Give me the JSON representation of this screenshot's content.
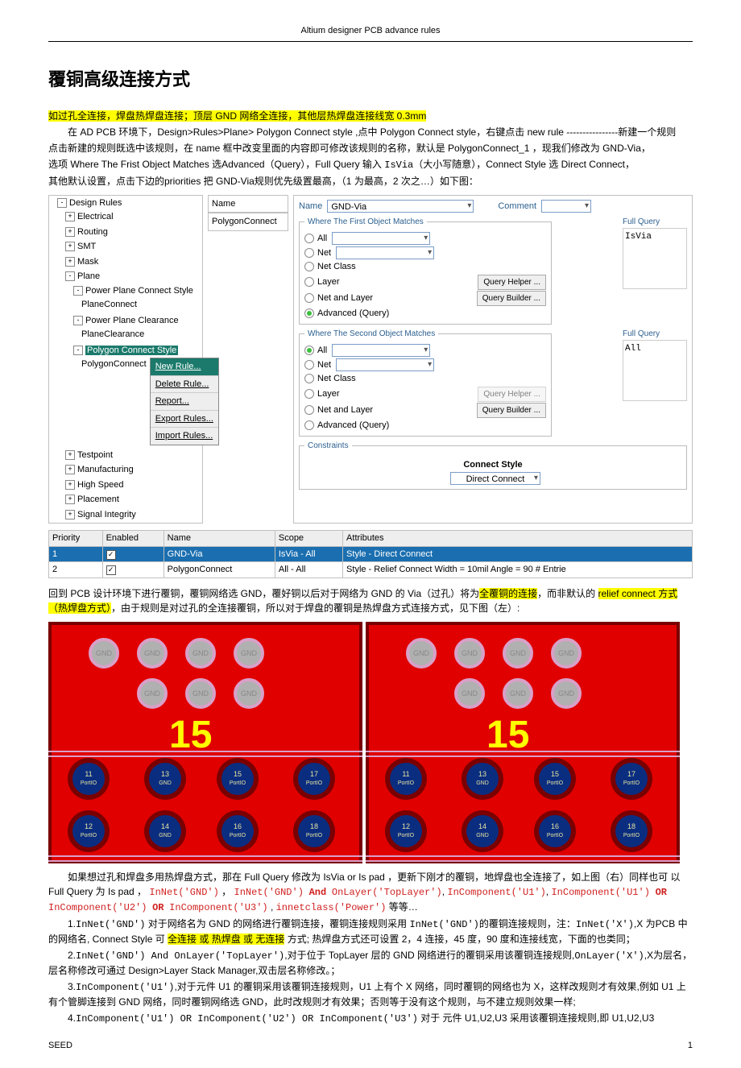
{
  "header": "Altium designer PCB advance rules",
  "title": "覆铜高级连接方式",
  "intro_hl": "如过孔全连接，焊盘热焊盘连接；顶层 GND 网络全连接，其他层热焊盘连接线宽 0.3mm",
  "p1_a": "在 AD PCB 环境下，Design>Rules>Plane> Polygon Connect style ,点中 Polygon Connect style，右键点击 new rule     ----------------新建一个规则",
  "p1_b": "点击新建的规则既选中该规则，在 name 框中改变里面的内容即可修改该规则的名称，默认是 PolygonConnect_1 ，现我们修改为 GND-Via，",
  "p1_c": "选项  Where The Frist Object Matches  选Advanced（Query），Full Query  输入 ",
  "p1_c_code": "IsVia",
  "p1_c2": "（大小写随意），Connect Style 选 Direct Connect，",
  "p1_d": "其他默认设置，点击下边的priorities  把 GND-Via规则优先级置最高，（1 为最高，2 次之…）如下图：",
  "tree": {
    "root": "Design Rules",
    "items": [
      "Electrical",
      "Routing",
      "SMT",
      "Mask",
      "Plane",
      "Power Plane Connect Style",
      "PlaneConnect",
      "Power Plane Clearance",
      "PlaneClearance",
      "Polygon Connect Style",
      "PolygonConnect",
      "Testpoint",
      "Manufacturing",
      "High Speed",
      "Placement",
      "Signal Integrity"
    ]
  },
  "ctx_menu": [
    "New Rule...",
    "Delete Rule...",
    "Report...",
    "Export Rules...",
    "Import Rules..."
  ],
  "name_col": {
    "head": "Name",
    "val": "PolygonConnect"
  },
  "panel": {
    "name_label": "Name",
    "name_val": "GND-Via",
    "comment_label": "Comment",
    "legend1": "Where The First Object Matches",
    "legend2": "Where The Second Object Matches",
    "legendFQ": "Full Query",
    "opts": [
      "All",
      "Net",
      "Net Class",
      "Layer",
      "Net and Layer",
      "Advanced (Query)"
    ],
    "helper": "Query Helper ...",
    "builder": "Query Builder ...",
    "fq1": "IsVia",
    "fq2": "All",
    "constraints_legend": "Constraints",
    "connect_style_label": "Connect Style",
    "connect_style_val": "Direct Connect"
  },
  "prio": {
    "cols": [
      "Priority",
      "Enabled",
      "Name",
      "Scope",
      "Attributes"
    ],
    "rows": [
      {
        "p": "1",
        "en": "✓",
        "name": "GND-Via",
        "scope": "IsVia   -   All",
        "attr": "Style - Direct Connect"
      },
      {
        "p": "2",
        "en": "✓",
        "name": "PolygonConnect",
        "scope": "All   -   All",
        "attr": "Style - Relief Connect    Width = 10mil    Angle = 90    # Entrie"
      }
    ]
  },
  "para2_a": "回到 PCB 设计环境下进行覆铜，覆铜网络选 GND，覆好铜以后对于网络为 GND 的 Via（过孔）将为",
  "para2_hl1": "全覆铜的连接",
  "para2_b": "，而非默认的 ",
  "para2_hl2": "relief connect 方式（热焊盘方式）",
  "para2_c": "，由于规则是对过孔的全连接覆铜，所以对于焊盘的覆铜是热焊盘方式连接方式，见下图（左）:",
  "big15": "15",
  "pad_gnd": "GND",
  "pad_labels": [
    {
      "t": "11",
      "b": "PortIO"
    },
    {
      "t": "13",
      "b": "GND"
    },
    {
      "t": "15",
      "b": "PortIO"
    },
    {
      "t": "17",
      "b": "PortIO"
    },
    {
      "t": "12",
      "b": "PortIO"
    },
    {
      "t": "14",
      "b": "GND"
    },
    {
      "t": "16",
      "b": "PortIO"
    },
    {
      "t": "18",
      "b": "PortIO"
    }
  ],
  "para3_a": "如果想过孔和焊盘多用热焊盘方式，那在 Full Query  修改为  IsVia or Is pad  ，更新下刚才的覆铜，地焊盘也全连接了，如上图（右）同样也可  以   Full   Query   为    Is   pad   ，",
  "para3_code1": "InNet('GND')",
  "para3_sep": " ， ",
  "para3_code2": "InNet('GND')",
  "para3_and": "And",
  "para3_code3": "OnLayer('TopLayer')",
  "para3_comma": ",   ",
  "para3_code4": "InComponent('U1')",
  "para3_comma2": ",",
  "para3_code5": "InComponent('U1')",
  "para3_or": "OR",
  "para3_code6": "InComponent('U2')",
  "para3_code7": "InComponent('U3')",
  "para3_comma3": " ,  ",
  "para3_code8": "innetclass('Power')",
  "para3_end": "等等…",
  "li1_a": "1.",
  "li1_code1": "InNet('GND')",
  "li1_b": " 对于网络名为 GND 的网络进行覆铜连接，覆铜连接规则采用 ",
  "li1_code2": "InNet('GND')",
  "li1_c": "的覆铜连接规则，注：",
  "li1_code3": "InNet('X')",
  "li1_d": ",X 为PCB 中的网络名, Connect Style 可 ",
  "li1_hl": "全连接 或 热焊盘 或 无连接",
  "li1_e": " 方式; 热焊盘方式还可设置 2，4 连接，45 度，90 度和连接线宽，下面的也类同；",
  "li2_a": "2.",
  "li2_code1": "InNet('GND') And OnLayer('TopLayer')",
  "li2_b": ",对于位于 TopLayer 层的 GND 网络进行的覆铜采用该覆铜连接规则,",
  "li2_code2": "OnLayer('X')",
  "li2_c": ",X为层名，层名称修改可通过 Design>Layer Stack Manager,双击层名称修改。；",
  "li3_a": "3.",
  "li3_code1": "InComponent('U1')",
  "li3_b": ",对于元件 U1 的覆铜采用该覆铜连接规则，U1 上有个 X 网络，同时覆铜的网络也为 X，这样改规则才有效果,例如 U1 上有个管脚连接到 GND 网络，同时覆铜网络选 GND，此时改规则才有效果；否则等于没有这个规则，与不建立规则效果一样;",
  "li4_a": "4.",
  "li4_code1": "InComponent('U1') OR InComponent('U2') OR InComponent('U3')",
  "li4_b": " 对于  元件 U1,U2,U3 采用该覆铜连接规则,即 U1,U2,U3",
  "footer_left": "SEED",
  "footer_right": "1"
}
